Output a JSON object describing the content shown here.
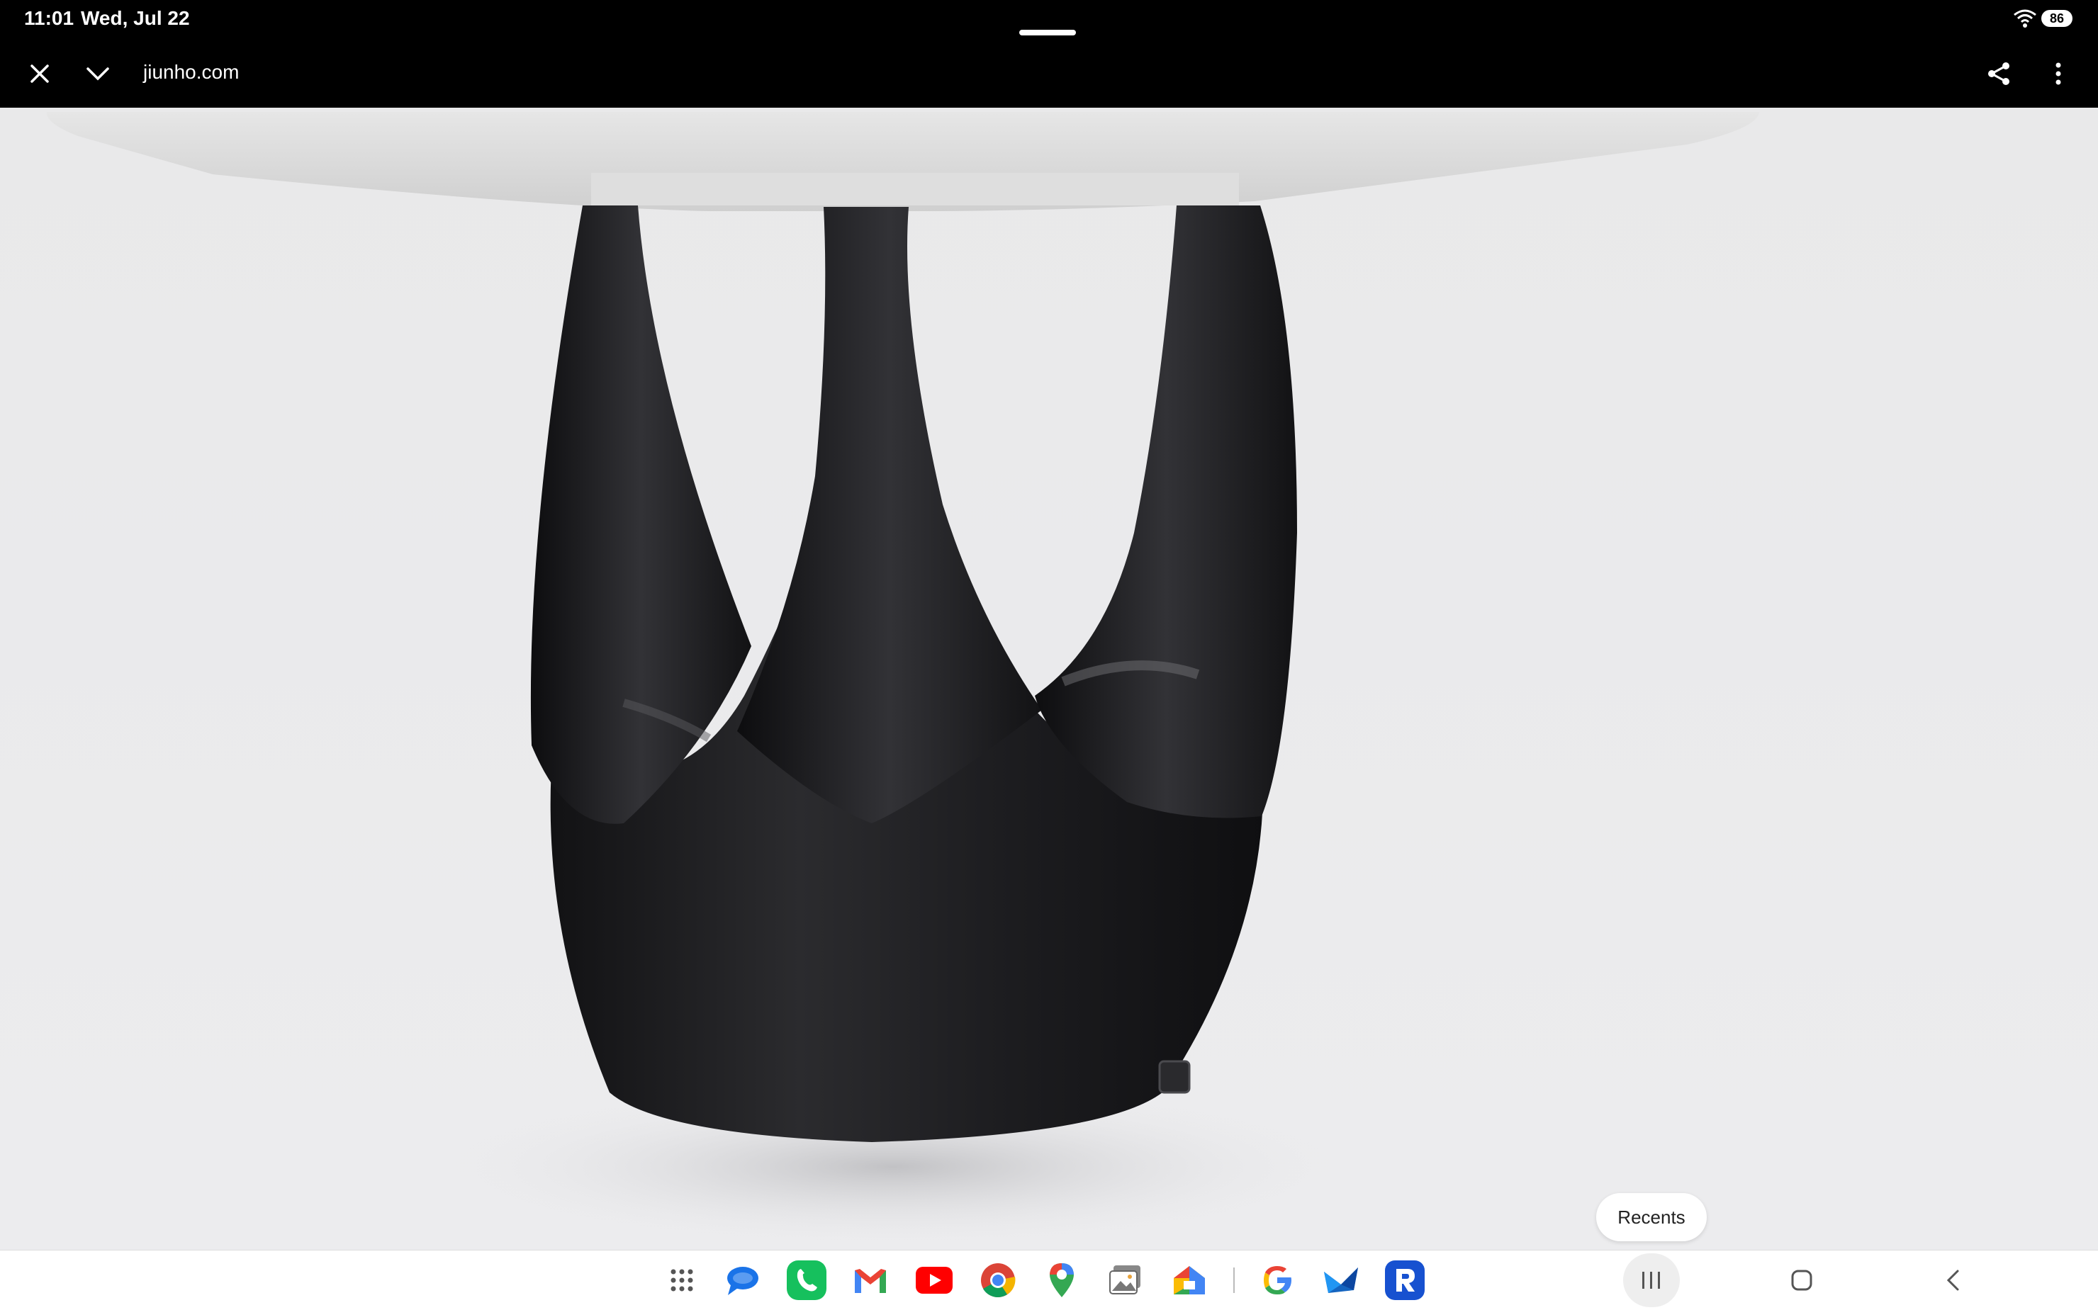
{
  "status_bar": {
    "time": "11:01",
    "date": "Wed, Jul 22",
    "battery": "86"
  },
  "browser": {
    "url": "jiunho.com"
  },
  "tooltip": {
    "recents_label": "Recents"
  },
  "colors": {
    "bar_bg": "#000000",
    "page_bg": "#ebebec",
    "table_top": "#dcdcdc",
    "table_base": "#1b1b1d"
  },
  "dock": {
    "apps": [
      "app-drawer-icon",
      "messages-icon",
      "phone-icon",
      "gmail-icon",
      "youtube-icon",
      "chrome-icon",
      "maps-icon",
      "gallery-icon",
      "google-home-icon",
      "google-icon",
      "mail-icon",
      "remote-app-icon"
    ]
  }
}
